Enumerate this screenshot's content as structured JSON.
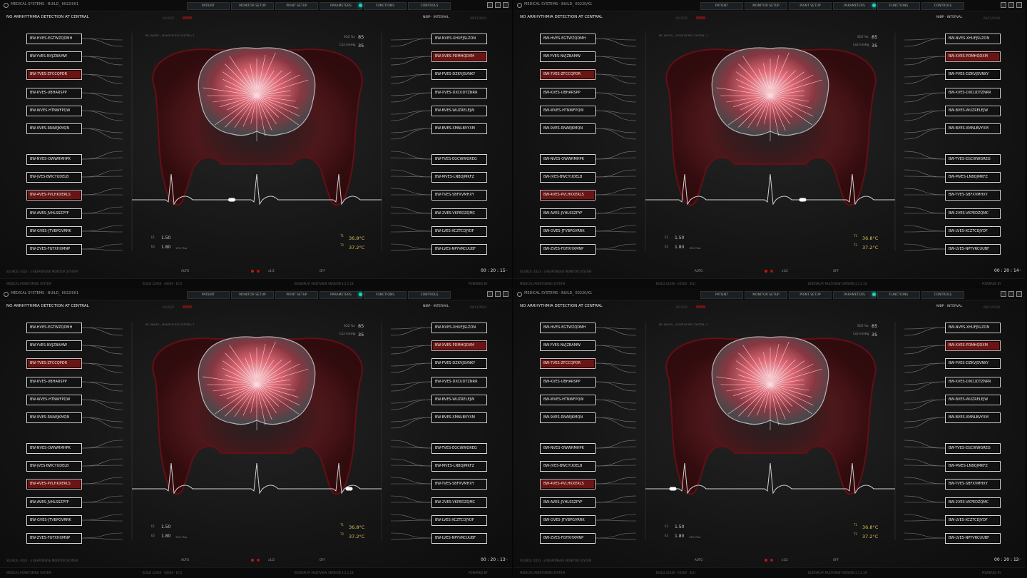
{
  "app": {
    "title": "MEDICAL SYSTEMS - BUILD_ 6022II/K1",
    "tabs": [
      "PATIENT",
      "MONITOR SETUP",
      "PRINT SETUP",
      "PARAMETERS",
      "FUNCTIONS",
      "CONTROLS"
    ]
  },
  "header": {
    "alert": "NO ARRHYTHMIA DETECTION AT CENTRAL",
    "tagline": "PAUSED",
    "nibp": "NIBP · INTERVAL",
    "date": "09/11/2024"
  },
  "region_label": "BR. WAVES _ MONITOR REC SYSTEM / 1",
  "readouts": {
    "spo2_label": "SOZ %s",
    "spo2_value": "85",
    "co2_label": "Co2 mmHg",
    "co2_value": "35",
    "t1_label": "T1",
    "t1_value": "36.8°C",
    "t2_label": "T2",
    "t2_value": "37.2°C",
    "e1_label": "E1",
    "e1_value": "1.50",
    "e2_label": "E2",
    "e2_value": "1.80",
    "pct": "19% Thor"
  },
  "left_channels": [
    {
      "label": "BW-HVES-EGTWZQDMH",
      "highlight": false
    },
    {
      "label": "BW-YVES-NVJZBAMW",
      "highlight": false
    },
    {
      "label": "BW-7VES-ZFCCQPDR",
      "highlight": true
    },
    {
      "label": "BW-KVES-UBHARSPP",
      "highlight": false
    },
    {
      "label": "BW-WVES-HTNWFPQW",
      "highlight": false
    },
    {
      "label": "BW-9VES-RNAEJKMQN",
      "highlight": false
    },
    {
      "label": "BW-NVES-OWWRMHPK",
      "highlight": false
    },
    {
      "label": "BW-JVES-BWCYUDELB",
      "highlight": false
    },
    {
      "label": "BW-4VES-PVLHKXERLS",
      "highlight": true
    },
    {
      "label": "BW-AVES-JVHLSSZPYF",
      "highlight": false
    },
    {
      "label": "BW-GVES-JTVBPGVRRK",
      "highlight": false
    },
    {
      "label": "BW-ZVES-FGTXHXMNP",
      "highlight": false
    }
  ],
  "right_channels": [
    {
      "label": "BW-NVES-XHUFJSLZON",
      "highlight": false
    },
    {
      "label": "BW-XVES-PDMHQDXM",
      "highlight": true
    },
    {
      "label": "BW-PVES-DZKVJSVNKY",
      "highlight": false
    },
    {
      "label": "BW-XVES-DXCUDTZNRR",
      "highlight": false
    },
    {
      "label": "BW-BVES-WUZRELEJW",
      "highlight": false
    },
    {
      "label": "BW-BVES-XMNLBVYXM",
      "highlight": false
    },
    {
      "label": "BW-TVES-EGCWWGREG",
      "highlight": false
    },
    {
      "label": "BW-MVES-LNBQJMKFZ",
      "highlight": false
    },
    {
      "label": "BW-TVES-SBFXVMHXY",
      "highlight": false
    },
    {
      "label": "BW-2VES-VKPEDZQMC",
      "highlight": false
    },
    {
      "label": "BW-LVES-XCZTCDJYDF",
      "highlight": false
    },
    {
      "label": "BW-LVES-NPYVRCUUBF",
      "highlight": false
    }
  ],
  "footer": {
    "source": "SOURCE: 4023 · 3    RESPONSIVE MONITOR SYSTEM",
    "auto": "AUTO",
    "speed": "x1/2",
    "mode": "OFF"
  },
  "statusbar": {
    "left": "MEDICAL MONITORING SYSTEM",
    "build": "BUILD 22A40 · 04500 · [K1]",
    "version": "BODISPLAY MULTIVIEW VERSION 3.5.2.18",
    "powered": "POWERED BY"
  },
  "panels": [
    {
      "timer": "00 : 20 : 15",
      "timer_sub": "/ 09",
      "ecg_x": 0.4
    },
    {
      "timer": "00 : 20 : 14",
      "timer_sub": "/ 09",
      "ecg_x": 0.63
    },
    {
      "timer": "00 : 20 : 13",
      "timer_sub": "/ 09",
      "ecg_x": 0.87
    },
    {
      "timer": "00 : 20 : 12",
      "timer_sub": "/ 09",
      "ecg_x": 0.11
    }
  ],
  "colors": {
    "accent": "#19d4c2",
    "highlight": "#6b1414",
    "brain": "#ff3a52",
    "warn_yellow": "#d8c05a"
  }
}
